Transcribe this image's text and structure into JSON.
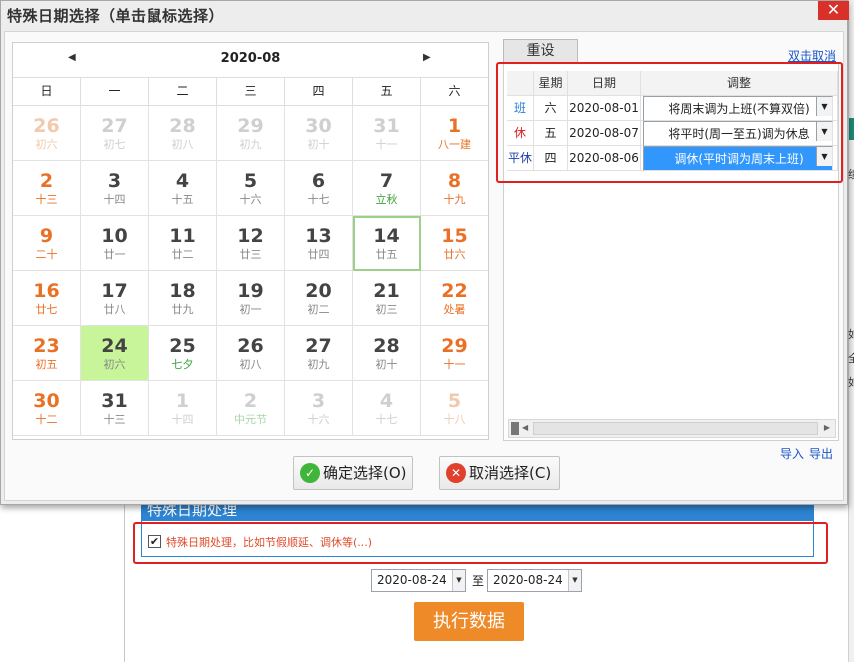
{
  "dialog": {
    "title": "特殊日期选择（单击鼠标选择）",
    "close_label": "✕",
    "confirm_label": "确定选择(O)",
    "cancel_label": "取消选择(C)"
  },
  "calendar": {
    "month_label": "2020-08",
    "prev_label": "◀",
    "next_label": "▶",
    "weekdays": [
      "日",
      "一",
      "二",
      "三",
      "四",
      "五",
      "六"
    ],
    "cells": [
      {
        "d": "26",
        "l": "初六",
        "other": true
      },
      {
        "d": "27",
        "l": "初七",
        "other": true
      },
      {
        "d": "28",
        "l": "初八",
        "other": true
      },
      {
        "d": "29",
        "l": "初九",
        "other": true
      },
      {
        "d": "30",
        "l": "初十",
        "other": true
      },
      {
        "d": "31",
        "l": "十一",
        "other": true
      },
      {
        "d": "1",
        "l": "八一建"
      },
      {
        "d": "2",
        "l": "十三"
      },
      {
        "d": "3",
        "l": "十四"
      },
      {
        "d": "4",
        "l": "十五"
      },
      {
        "d": "5",
        "l": "十六"
      },
      {
        "d": "6",
        "l": "十七"
      },
      {
        "d": "7",
        "l": "立秋",
        "term": true
      },
      {
        "d": "8",
        "l": "十九"
      },
      {
        "d": "9",
        "l": "二十"
      },
      {
        "d": "10",
        "l": "廿一"
      },
      {
        "d": "11",
        "l": "廿二"
      },
      {
        "d": "12",
        "l": "廿三"
      },
      {
        "d": "13",
        "l": "廿四"
      },
      {
        "d": "14",
        "l": "廿五",
        "today": true
      },
      {
        "d": "15",
        "l": "廿六"
      },
      {
        "d": "16",
        "l": "廿七"
      },
      {
        "d": "17",
        "l": "廿八"
      },
      {
        "d": "18",
        "l": "廿九"
      },
      {
        "d": "19",
        "l": "初一"
      },
      {
        "d": "20",
        "l": "初二"
      },
      {
        "d": "21",
        "l": "初三"
      },
      {
        "d": "22",
        "l": "处暑"
      },
      {
        "d": "23",
        "l": "初五"
      },
      {
        "d": "24",
        "l": "初六",
        "selected": true
      },
      {
        "d": "25",
        "l": "七夕",
        "term": true
      },
      {
        "d": "26",
        "l": "初八"
      },
      {
        "d": "27",
        "l": "初九"
      },
      {
        "d": "28",
        "l": "初十"
      },
      {
        "d": "29",
        "l": "十一"
      },
      {
        "d": "30",
        "l": "十二"
      },
      {
        "d": "31",
        "l": "十三"
      },
      {
        "d": "1",
        "l": "十四",
        "other": true
      },
      {
        "d": "2",
        "l": "中元节",
        "other": true,
        "term": true
      },
      {
        "d": "3",
        "l": "十六",
        "other": true
      },
      {
        "d": "4",
        "l": "十七",
        "other": true
      },
      {
        "d": "5",
        "l": "十八",
        "other": true
      }
    ]
  },
  "panel": {
    "reset_tab": "重设",
    "dbl_cancel": "双击取消",
    "columns": [
      "",
      "星期",
      "日期",
      "调整"
    ],
    "rows": [
      {
        "type": "班",
        "type_color": "#2a7fd8",
        "week": "六",
        "date": "2020-08-01",
        "adjust": "将周末调为上班(不算双倍)",
        "active": false
      },
      {
        "type": "休",
        "type_color": "#d82020",
        "week": "五",
        "date": "2020-08-07",
        "adjust": "将平时(周一至五)调为休息",
        "active": false
      },
      {
        "type": "平休",
        "type_color": "#1a3fb0",
        "week": "四",
        "date": "2020-08-06",
        "adjust": "调休(平时调为周末上班)",
        "active": true
      }
    ],
    "import_label": "导入",
    "export_label": "导出"
  },
  "page": {
    "section_title": "特殊日期处理",
    "checkbox_checked": true,
    "checkbox_label": "特殊日期处理，比如节假顺延、调休等(...)",
    "date_from": "2020-08-24",
    "to_label": "至",
    "date_to": "2020-08-24",
    "execute_label": "执行数据",
    "right_glyphs": [
      "绩",
      "如",
      "全",
      "如"
    ]
  },
  "colors": {
    "accent_blue": "#2c84d2",
    "execute_orange": "#ef8a28",
    "weekend_orange": "#ea7025",
    "highlight_red": "#e02020",
    "selected_green": "#c8f59a"
  }
}
